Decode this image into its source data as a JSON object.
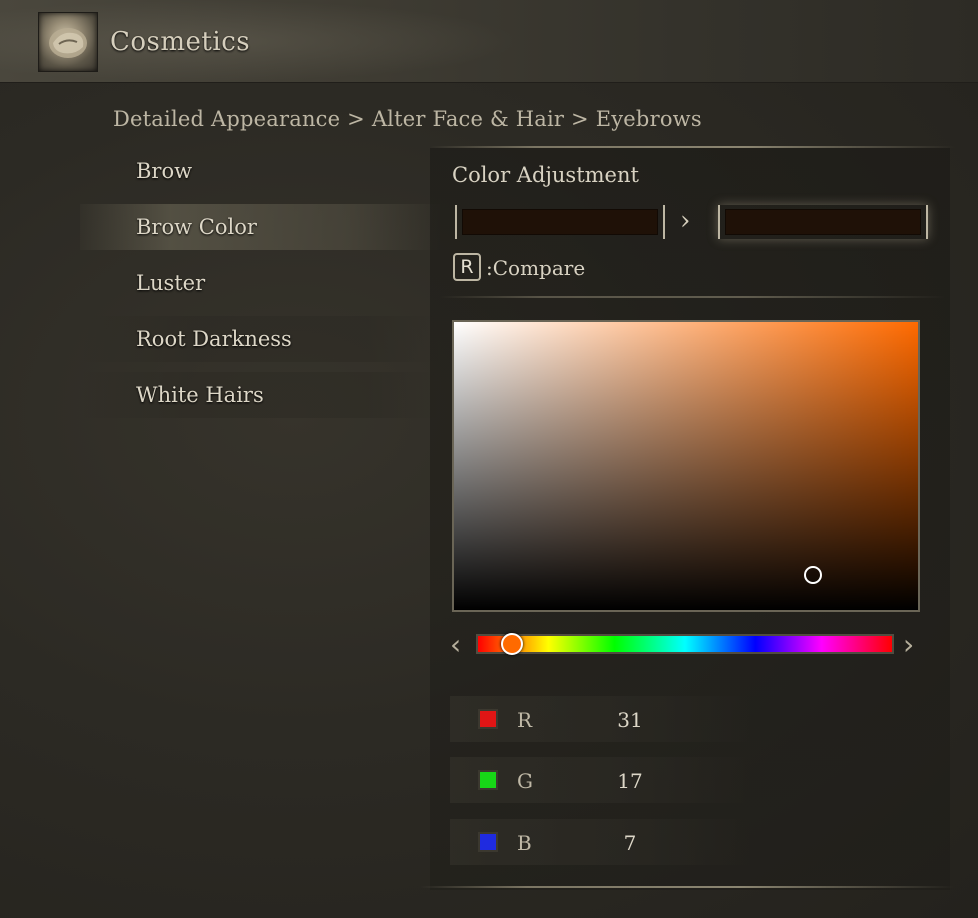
{
  "header": {
    "title": "Cosmetics",
    "icon": "face-appearance-icon"
  },
  "breadcrumb": "Detailed Appearance > Alter Face & Hair > Eyebrows",
  "menu": {
    "items": [
      {
        "label": "Brow",
        "selected": false
      },
      {
        "label": "Brow Color",
        "selected": true
      },
      {
        "label": "Luster",
        "selected": false
      },
      {
        "label": "Root Darkness",
        "selected": false
      },
      {
        "label": "White Hairs",
        "selected": false
      }
    ]
  },
  "color_panel": {
    "title": "Color Adjustment",
    "compare_key": "R",
    "compare_label": ":Compare",
    "previous_color": "#1f1107",
    "current_color": "#1f1107",
    "hue_base_color": "#ff6a00",
    "channels": [
      {
        "label": "R",
        "value": "31",
        "color": "#e01515"
      },
      {
        "label": "G",
        "value": "17",
        "color": "#17d617"
      },
      {
        "label": "B",
        "value": "7",
        "color": "#1f2be0"
      }
    ]
  }
}
